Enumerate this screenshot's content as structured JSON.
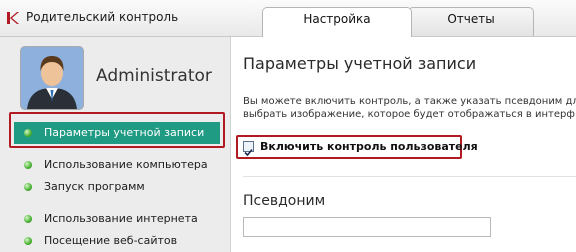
{
  "window": {
    "title": "Родительский контроль",
    "icon": "kaspersky-k-icon"
  },
  "tabs": [
    {
      "label": "Настройка",
      "active": true
    },
    {
      "label": "Отчеты",
      "active": false
    }
  ],
  "sidebar": {
    "user": {
      "name": "Administrator",
      "avatar": "user-avatar-icon"
    },
    "items": [
      {
        "label": "Параметры учетной записи",
        "active": true
      },
      {
        "label": "Использование компьютера",
        "active": false
      },
      {
        "label": "Запуск программ",
        "active": false
      },
      {
        "label": "Использование интернета",
        "active": false
      },
      {
        "label": "Посещение веб-сайтов",
        "active": false
      }
    ]
  },
  "main": {
    "title": "Параметры учетной записи",
    "description_line1": "Вы можете включить контроль, а также указать псевдоним дл",
    "description_line2": "выбрать изображение, которое будет отображаться в интерф",
    "enable_checkbox": {
      "label": "Включить контроль пользователя",
      "checked": true
    },
    "alias": {
      "title": "Псевдоним",
      "value": "",
      "placeholder": ""
    }
  },
  "colors": {
    "accent_teal": "#1f9a83",
    "highlight_red": "#b11a22",
    "bullet_green": "#46b02f"
  }
}
